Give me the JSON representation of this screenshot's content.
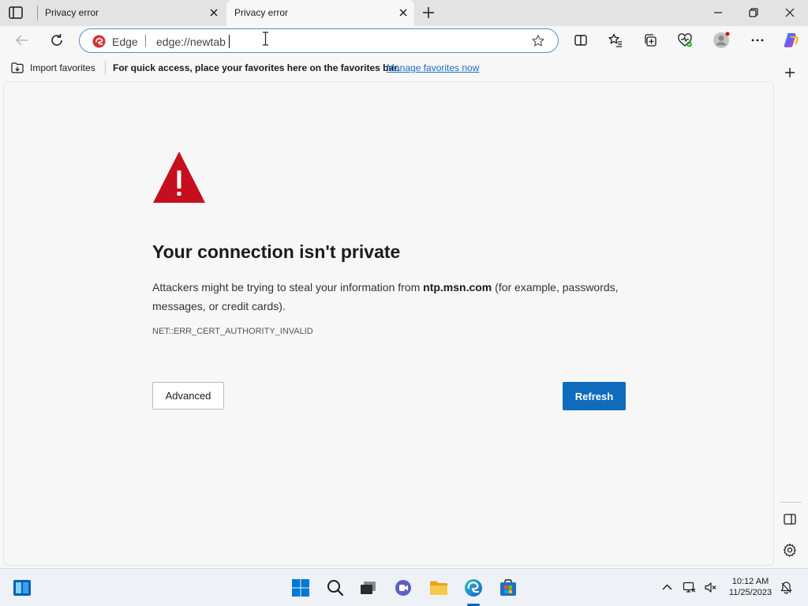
{
  "tabs": [
    {
      "title": "Privacy error",
      "active": false
    },
    {
      "title": "Privacy error",
      "active": true
    }
  ],
  "address_bar": {
    "site_label": "Edge",
    "url": "edge://newtab"
  },
  "favorites_bar": {
    "import_label": "Import favorites",
    "hint": "For quick access, place your favorites here on the favorites bar.",
    "manage_link": "Manage favorites now"
  },
  "error_page": {
    "title": "Your connection isn't private",
    "description_prefix": "Attackers might be trying to steal your information from ",
    "host": "ntp.msn.com",
    "description_suffix": " (for example, passwords, messages, or credit cards).",
    "error_code": "NET::ERR_CERT_AUTHORITY_INVALID",
    "advanced_label": "Advanced",
    "refresh_label": "Refresh"
  },
  "taskbar": {
    "time": "10:12 AM",
    "date": "11/25/2023"
  },
  "colors": {
    "accent": "#0f6cbd",
    "warning_red": "#c50f1f",
    "link": "#1b6ec1"
  },
  "icons": [
    "tab-actions-icon",
    "close-icon",
    "new-tab-icon",
    "minimize-icon",
    "restore-icon",
    "window-close-icon",
    "back-icon",
    "refresh-icon",
    "edge-logo-icon",
    "favorite-star-icon",
    "split-screen-icon",
    "favorites-icon",
    "collections-icon",
    "browser-essentials-icon",
    "profile-icon",
    "more-icon",
    "copilot-icon",
    "import-icon",
    "warning-icon",
    "add-icon",
    "sidebar-toggle-icon",
    "settings-icon",
    "widgets-icon",
    "start-icon",
    "search-icon",
    "task-view-icon",
    "chat-icon",
    "file-explorer-icon",
    "edge-icon",
    "store-icon",
    "chevron-up-icon",
    "network-icon",
    "volume-muted-icon",
    "notification-icon"
  ]
}
